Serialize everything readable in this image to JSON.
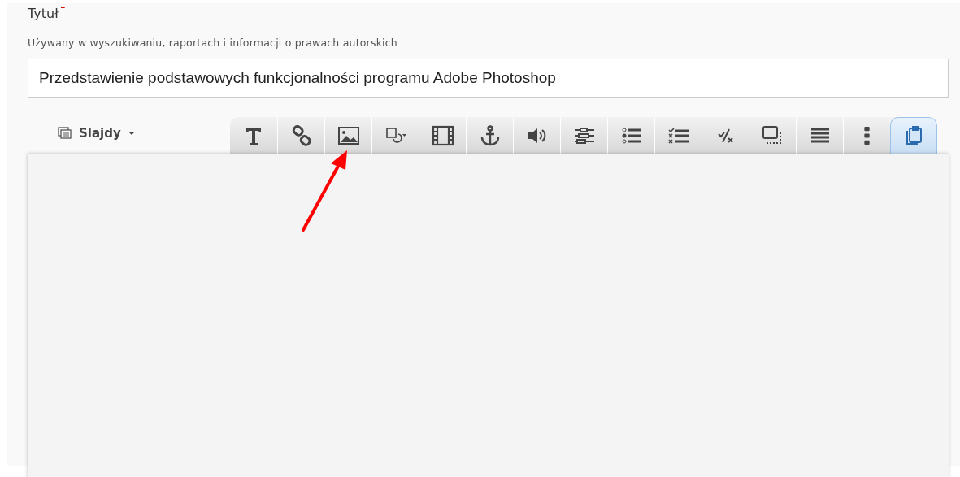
{
  "field": {
    "label": "Tytuł",
    "required": true,
    "hint": "Używany w wyszukiwaniu, raportach i informacji o prawach autorskich",
    "value": "Przedstawienie podstawowych funkcjonalności programu Adobe Photoshop"
  },
  "slides_menu": {
    "label": "Slajdy"
  },
  "toolbar": [
    {
      "kind": "text",
      "selected": false
    },
    {
      "kind": "link",
      "selected": false
    },
    {
      "kind": "image",
      "selected": false
    },
    {
      "kind": "shape",
      "selected": false
    },
    {
      "kind": "video",
      "selected": false
    },
    {
      "kind": "anchor",
      "selected": false
    },
    {
      "kind": "audio",
      "selected": false
    },
    {
      "kind": "fields",
      "selected": false
    },
    {
      "kind": "choice",
      "selected": false
    },
    {
      "kind": "checklist",
      "selected": false
    },
    {
      "kind": "truefalse",
      "selected": false
    },
    {
      "kind": "dragdrop",
      "selected": false
    },
    {
      "kind": "list",
      "selected": false
    },
    {
      "kind": "more",
      "selected": false
    },
    {
      "kind": "paste",
      "selected": true
    }
  ]
}
